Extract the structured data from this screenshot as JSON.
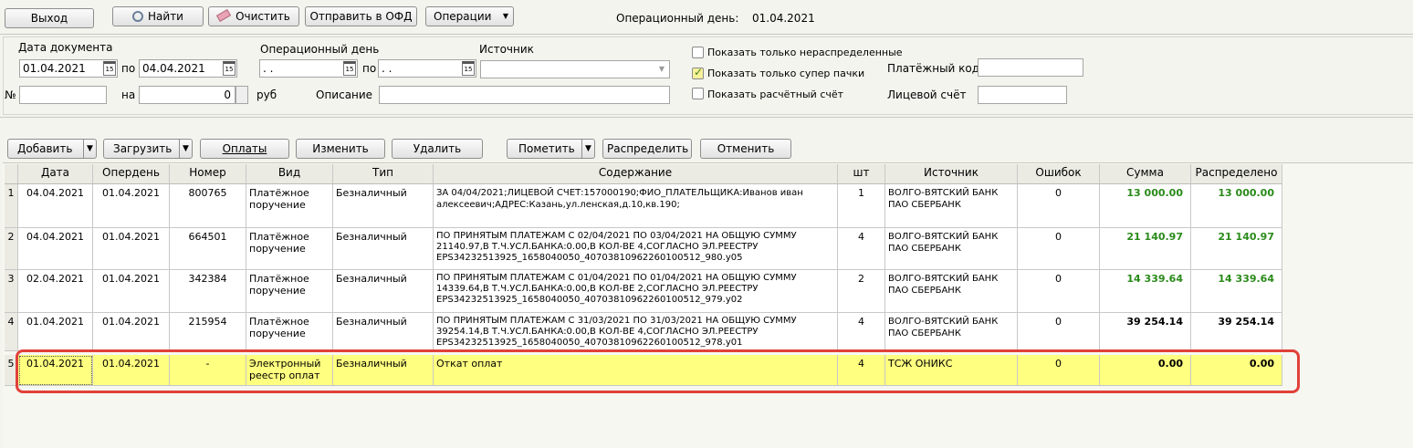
{
  "toolbar": {
    "exit_label": "Выход",
    "find_label": "Найти",
    "clear_label": "Очистить",
    "send_ofd_label": "Отправить в ОФД",
    "operations_label": "Операции",
    "opday_label": "Операционный день:",
    "opday_value": "01.04.2021"
  },
  "filters": {
    "doc_date_label": "Дата документа",
    "doc_date_from": "01.04.2021",
    "doc_date_po": "по",
    "doc_date_to": "04.04.2021",
    "opday_label": "Операционный день",
    "opday_from": " .  .",
    "opday_po": "по",
    "opday_to": " .  .",
    "source_label": "Источник",
    "source_value": "",
    "num_label": "№",
    "num_value": "",
    "na_label": "на",
    "amount_value": "0",
    "rub_label": "руб",
    "description_label": "Описание",
    "description_value": "",
    "only_unallocated_label": "Показать только нераспределенные",
    "only_unallocated_checked": false,
    "only_super_packs_label": "Показать только супер пачки",
    "only_super_packs_checked": true,
    "show_account_label": "Показать расчётный счёт",
    "show_account_checked": false,
    "payment_code_label": "Платёжный код",
    "payment_code_value": "",
    "personal_account_label": "Лицевой счёт",
    "personal_account_value": ""
  },
  "actions": {
    "add_label": "Добавить",
    "load_label": "Загрузить",
    "payments_label": "Оплаты",
    "edit_label": "Изменить",
    "delete_label": "Удалить",
    "mark_label": "Пометить",
    "distribute_label": "Распределить",
    "cancel_label": "Отменить"
  },
  "table": {
    "headers": [
      "",
      "Дата",
      "Опердень",
      "Номер",
      "Вид",
      "Тип",
      "Содержание",
      "шт",
      "Источник",
      "Ошибок",
      "Сумма",
      "Распределено"
    ],
    "rows": [
      {
        "n": "1",
        "date": "04.04.2021",
        "opday": "01.04.2021",
        "number": "800765",
        "kind": "Платёжное поручение",
        "type": "Безналичный",
        "content": "ЗА 04/04/2021;ЛИЦЕВОЙ СЧЕТ:157000190;ФИО_ПЛАТЕЛЬЩИКА:Иванов иван алексеевич;АДРЕС:Казань,ул.ленская,д.10,кв.190;",
        "qty": "1",
        "source": "ВОЛГО-ВЯТСКИЙ БАНК ПАО СБЕРБАНК",
        "errors": "0",
        "sum": "13 000.00",
        "distributed": "13 000.00",
        "green": true
      },
      {
        "n": "2",
        "date": "04.04.2021",
        "opday": "01.04.2021",
        "number": "664501",
        "kind": "Платёжное поручение",
        "type": "Безналичный",
        "content": "ПО ПРИНЯТЫМ ПЛАТЕЖАМ С 02/04/2021 ПО 03/04/2021 НА ОБЩУЮ СУММУ 21140.97,В Т.Ч.УСЛ.БАНКА:0.00,В КОЛ-ВЕ 4,СОГЛАСНО ЭЛ.РЕЕСТРУ EPS34232513925_1658040050_40703810962260100512_980.y05",
        "qty": "4",
        "source": "ВОЛГО-ВЯТСКИЙ БАНК ПАО СБЕРБАНК",
        "errors": "0",
        "sum": "21 140.97",
        "distributed": "21 140.97",
        "green": true
      },
      {
        "n": "3",
        "date": "02.04.2021",
        "opday": "01.04.2021",
        "number": "342384",
        "kind": "Платёжное поручение",
        "type": "Безналичный",
        "content": "ПО ПРИНЯТЫМ ПЛАТЕЖАМ С 01/04/2021 ПО 01/04/2021 НА ОБЩУЮ СУММУ 14339.64,В Т.Ч.УСЛ.БАНКА:0.00,В КОЛ-ВЕ 2,СОГЛАСНО ЭЛ.РЕЕСТРУ EPS34232513925_1658040050_40703810962260100512_979.y02",
        "qty": "2",
        "source": "ВОЛГО-ВЯТСКИЙ БАНК ПАО СБЕРБАНК",
        "errors": "0",
        "sum": "14 339.64",
        "distributed": "14 339.64",
        "green": true
      },
      {
        "n": "4",
        "date": "01.04.2021",
        "opday": "01.04.2021",
        "number": "215954",
        "kind": "Платёжное поручение",
        "type": "Безналичный",
        "content": "ПО ПРИНЯТЫМ ПЛАТЕЖАМ С 31/03/2021 ПО 31/03/2021 НА ОБЩУЮ СУММУ 39254.14,В Т.Ч.УСЛ.БАНКА:0.00,В КОЛ-ВЕ 4,СОГЛАСНО ЭЛ.РЕЕСТРУ EPS34232513925_1658040050_40703810962260100512_978.y01",
        "qty": "4",
        "source": "ВОЛГО-ВЯТСКИЙ БАНК ПАО СБЕРБАНК",
        "errors": "0",
        "sum": "39 254.14",
        "distributed": "39 254.14",
        "green": false
      },
      {
        "n": "5",
        "date": "01.04.2021",
        "opday": "01.04.2021",
        "number": "-",
        "kind": "Электронный реестр оплат",
        "type": "Безналичный",
        "content": "Откат оплат",
        "qty": "4",
        "source": "ТСЖ ОНИКС",
        "errors": "0",
        "sum": "0.00",
        "distributed": "0.00",
        "green": false,
        "selected": true
      }
    ]
  },
  "colors": {
    "highlight_border": "#e0413a",
    "selected_row": "#ffff80",
    "green_amount": "#2a8a1a"
  }
}
